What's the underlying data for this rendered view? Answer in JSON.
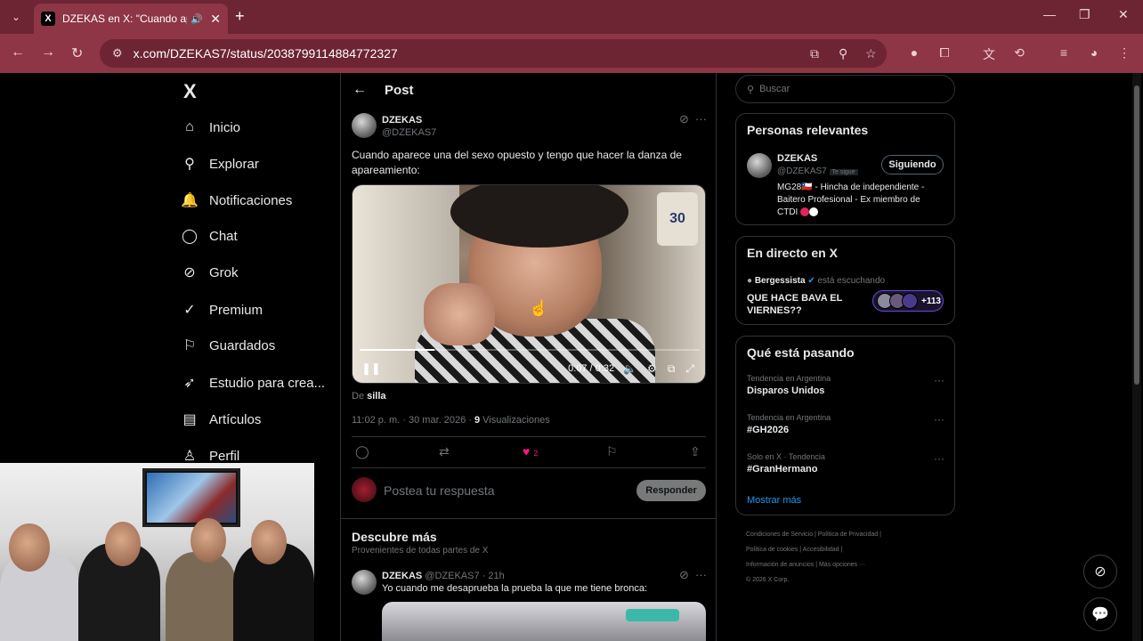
{
  "browser": {
    "tab_title": "DZEKAS en X: \"Cuando apa",
    "tab_favicon": "X",
    "url": "x.com/DZEKAS7/status/2038799114884772327",
    "accent_frame": "#6d2433",
    "accent_bar": "#8e3546"
  },
  "nav": {
    "logo": "X",
    "items": [
      {
        "icon": "home-icon",
        "glyph": "⌂",
        "label": "Inicio"
      },
      {
        "icon": "search-icon",
        "glyph": "⚲",
        "label": "Explorar"
      },
      {
        "icon": "bell-icon",
        "glyph": "🔔",
        "label": "Notificaciones"
      },
      {
        "icon": "chat-icon",
        "glyph": "◯",
        "label": "Chat"
      },
      {
        "icon": "grok-icon",
        "glyph": "⊘",
        "label": "Grok"
      },
      {
        "icon": "premium-icon",
        "glyph": "✓",
        "label": "Premium"
      },
      {
        "icon": "bookmark-icon",
        "glyph": "⚐",
        "label": "Guardados"
      },
      {
        "icon": "rocket-icon",
        "glyph": "➶",
        "label": "Estudio para crea..."
      },
      {
        "icon": "article-icon",
        "glyph": "▤",
        "label": "Artículos"
      },
      {
        "icon": "profile-icon",
        "glyph": "♙",
        "label": "Perfil"
      }
    ]
  },
  "post": {
    "header_title": "Post",
    "author_name": "DZEKAS",
    "author_handle": "@DZEKAS7",
    "text": "Cuando aparece una del sexo opuesto y tengo que hacer la danza de apareamiento:",
    "video": {
      "current": "0:07",
      "duration": "0:32",
      "progress": 0.22,
      "badge": "30"
    },
    "from_prefix": "De",
    "from_name": "silla",
    "time": "11:02 p. m. · 30 mar. 2026 · ",
    "views_count": "9",
    "views_label": " Visualizaciones",
    "likes": "2",
    "reply_placeholder": "Postea tu respuesta",
    "reply_button": "Responder"
  },
  "discover": {
    "title": "Descubre más",
    "subtitle": "Provenientes de todas partes de X",
    "post_name": "DZEKAS",
    "post_handle": "@DZEKAS7 · 21h",
    "post_text": "Yo cuando me desaprueba la prueba la que me tiene bronca:"
  },
  "sidebar": {
    "search_placeholder": "Buscar",
    "relevant_title": "Personas relevantes",
    "relevant_name": "DZEKAS",
    "relevant_handle": "@DZEKAS7",
    "relevant_follows_you": "Te sigue",
    "follow_button": "Siguiendo",
    "bio_line1": "MG28🇨🇱 - Hincha de independiente - Baitero Profesional - Ex miembro de",
    "bio_line2": "CTDI",
    "live_title": "En directo en X",
    "live_host": "Bergessista",
    "live_host_suffix": " está escuchando",
    "live_topic": "QUE HACE BAVA EL VIERNES??",
    "live_count": "+113",
    "trends_title": "Qué está pasando",
    "trends": [
      {
        "ctx": "Tendencia en Argentina",
        "name": "Disparos Unidos"
      },
      {
        "ctx": "Tendencia en Argentina",
        "name": "#GH2026"
      },
      {
        "ctx": "Solo en X · Tendencia",
        "name": "#GranHermano"
      }
    ],
    "show_more": "Mostrar más",
    "footer_1": "Condiciones de Servicio  |  Política de Privacidad  |",
    "footer_2": "Política de cookies  |  Accesibilidad  |",
    "footer_3": "Información de anuncios  |  Más opciones ···",
    "footer_4": "© 2026 X Corp."
  }
}
